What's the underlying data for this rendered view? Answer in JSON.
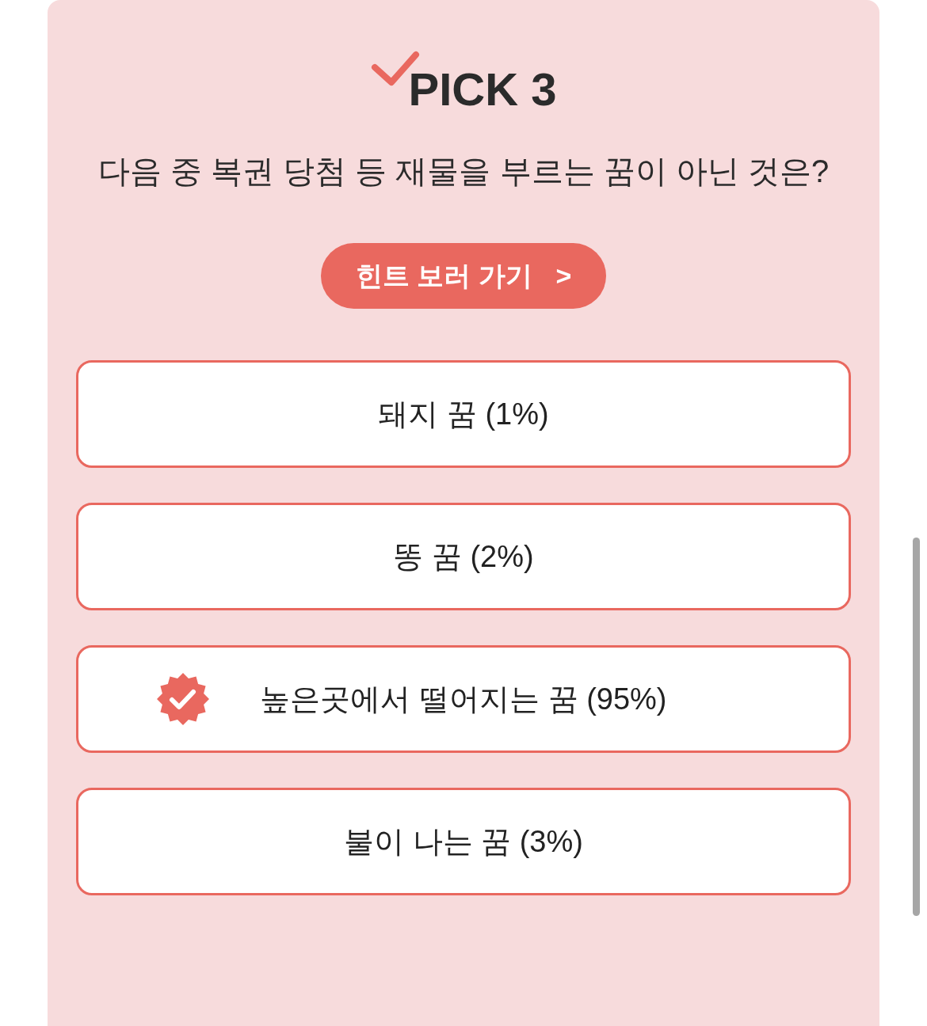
{
  "title": "PICK 3",
  "question": "다음 중 복권 당첨 등 재물을 부르는 꿈이 아닌 것은?",
  "hint_button": {
    "label": "힌트 보러 가기",
    "arrow": ">"
  },
  "options": [
    {
      "label": "돼지 꿈 (1%)",
      "selected": false
    },
    {
      "label": "똥 꿈 (2%)",
      "selected": false
    },
    {
      "label": "높은곳에서 떨어지는 꿈 (95%)",
      "selected": true
    },
    {
      "label": "불이 나는 꿈 (3%)",
      "selected": false
    }
  ]
}
